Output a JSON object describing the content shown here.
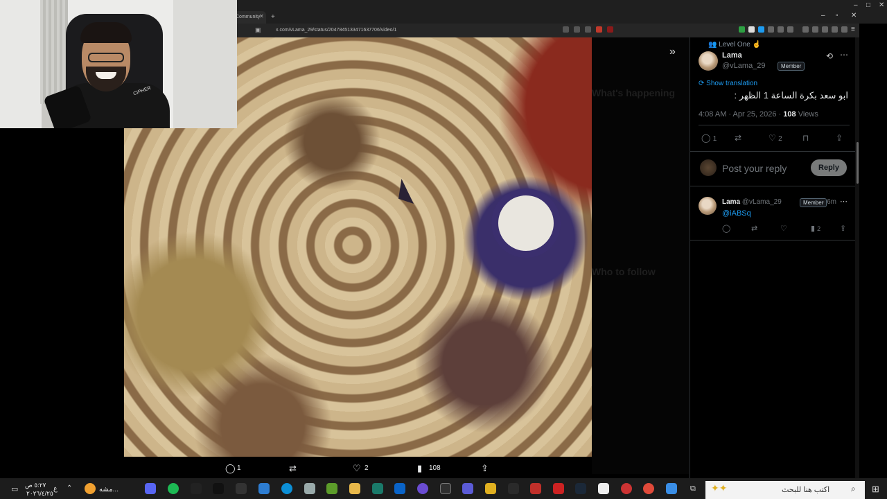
{
  "browser": {
    "tab_title": "Community",
    "url": "x.com/vLama_29/status/2047845133471637706/video/1"
  },
  "background_column": {
    "whats_happening": "What's happening",
    "who_to_follow": "Who to follow"
  },
  "post": {
    "community": "Level One ☝",
    "author_name": "Lama",
    "author_handle": "@vLama_29",
    "member_badge": "Member",
    "show_translation": "Show translation",
    "text": "ابو سعد بكرة الساعة 1 الظهر :",
    "timestamp": "4:08 AM · Apr 25, 2026 · ",
    "views_count": "108",
    "views_label": " Views",
    "replies": "1",
    "likes": "2"
  },
  "composer": {
    "placeholder": "Post your reply",
    "button": "Reply"
  },
  "reply": {
    "author_name": "Lama",
    "author_handle": "@vLama_29",
    "member_badge": "Member",
    "age": "· 6m",
    "text": "@iABSq",
    "views": "2"
  },
  "video_actions": {
    "replies": "1",
    "likes": "2",
    "views": "108"
  },
  "webcam": {
    "logo_text": "CIPHER"
  },
  "taskbar": {
    "search_placeholder": "اكتب هنا للبحث",
    "active_app_label": "مشه...",
    "time": "٥:٢٧ ص",
    "date": "٢٠٢٦/٤/٢٥",
    "lang": "ع"
  }
}
